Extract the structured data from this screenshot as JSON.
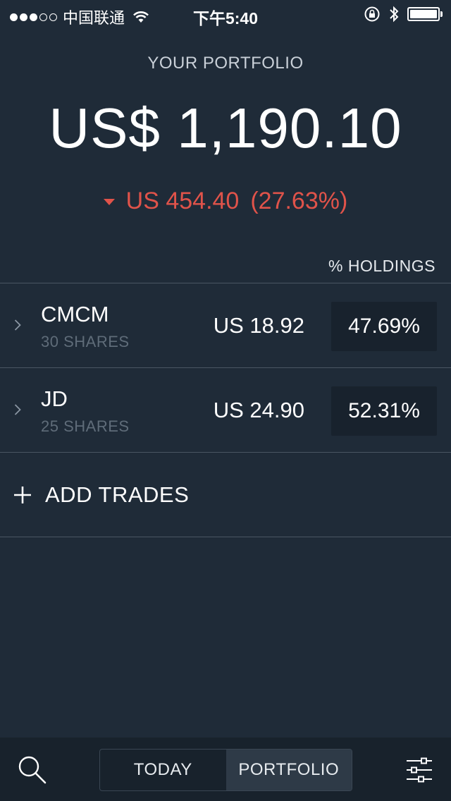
{
  "status_bar": {
    "carrier": "中国联通",
    "time": "下午5:40"
  },
  "header": {
    "label": "YOUR PORTFOLIO",
    "total_value": "US$ 1,190.10",
    "change_amount": "US 454.40",
    "change_percent": "(27.63%)",
    "change_direction": "down",
    "change_color": "#e0534a"
  },
  "holdings": {
    "column_header": "% HOLDINGS",
    "items": [
      {
        "symbol": "CMCM",
        "shares": "30 SHARES",
        "price": "US 18.92",
        "percent": "47.69%"
      },
      {
        "symbol": "JD",
        "shares": "25 SHARES",
        "price": "US 24.90",
        "percent": "52.31%"
      }
    ]
  },
  "add_trades": {
    "label": "ADD TRADES",
    "icon": "plus-icon"
  },
  "tab_bar": {
    "search_icon": "search-icon",
    "segments": [
      {
        "label": "TODAY",
        "active": false
      },
      {
        "label": "PORTFOLIO",
        "active": true
      }
    ],
    "settings_icon": "sliders-icon"
  },
  "colors": {
    "background": "#1f2b38",
    "negative": "#e0534a",
    "muted_text": "#5f6c79"
  }
}
